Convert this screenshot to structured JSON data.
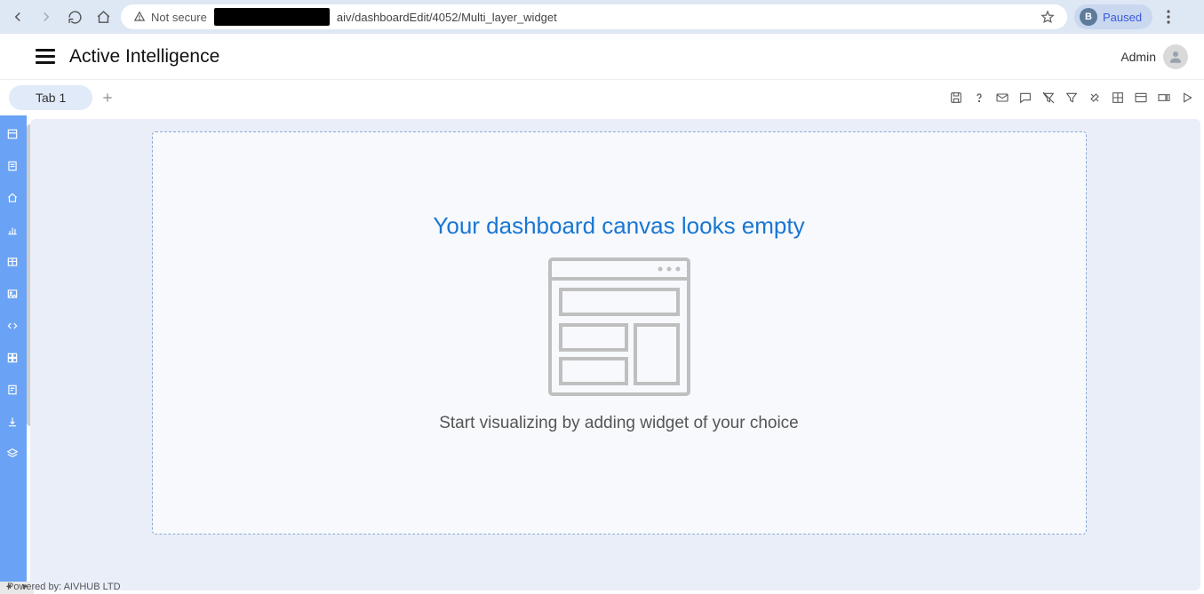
{
  "browser": {
    "not_secure_label": "Not secure",
    "url_visible": "aiv/dashboardEdit/4052/Multi_layer_widget",
    "profile_letter": "B",
    "profile_status": "Paused"
  },
  "header": {
    "app_title": "Active Intelligence",
    "user_label": "Admin"
  },
  "tabs": {
    "items": [
      {
        "label": "Tab 1"
      }
    ]
  },
  "toolbar": {
    "icons": [
      "save-icon",
      "help-icon",
      "mail-icon",
      "comment-icon",
      "funnel-off-icon",
      "funnel-icon",
      "tools-icon",
      "grid-icon",
      "layout-icon",
      "widget-icon",
      "play-icon"
    ]
  },
  "siderail": {
    "icons": [
      "dataset-icon",
      "report-icon",
      "home-icon",
      "chart-icon",
      "table-icon",
      "image-icon",
      "code-icon",
      "grid2-icon",
      "form-icon",
      "export-icon",
      "layer-icon",
      "more-icon"
    ]
  },
  "canvas": {
    "empty_title": "Your dashboard canvas looks empty",
    "empty_subtitle": "Start visualizing by adding widget of your choice"
  },
  "footer": {
    "text": "Powered by: AIVHUB LTD"
  }
}
